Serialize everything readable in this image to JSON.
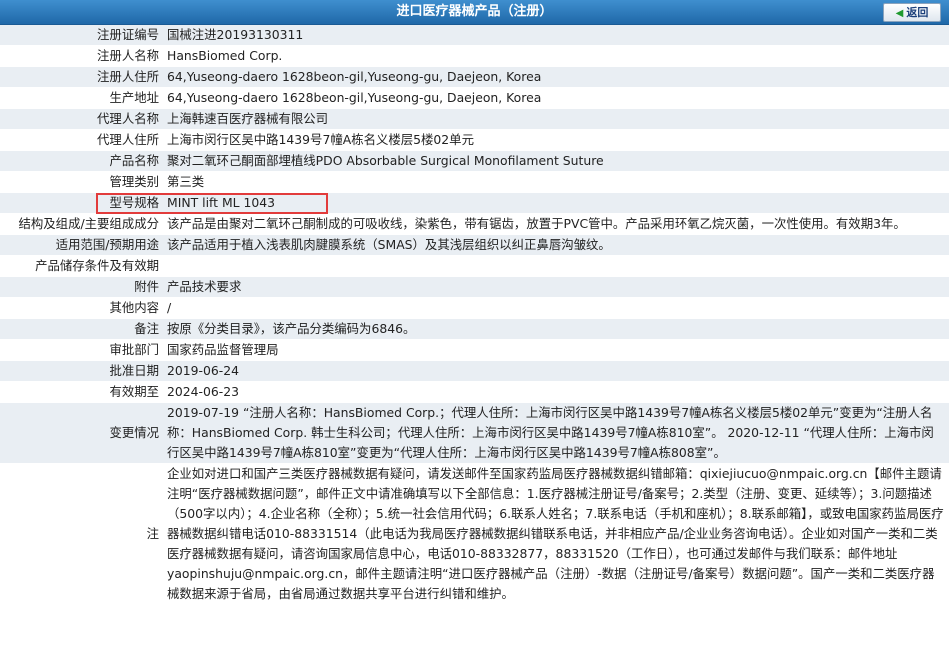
{
  "header": {
    "title": "进口医疗器械产品（注册）",
    "back_label": "返回"
  },
  "rows": [
    {
      "label": "注册证编号",
      "value": "国械注进20193130311"
    },
    {
      "label": "注册人名称",
      "value": "HansBiomed Corp."
    },
    {
      "label": "注册人住所",
      "value": "64,Yuseong-daero 1628beon-gil,Yuseong-gu, Daejeon, Korea"
    },
    {
      "label": "生产地址",
      "value": "64,Yuseong-daero 1628beon-gil,Yuseong-gu, Daejeon, Korea"
    },
    {
      "label": "代理人名称",
      "value": "上海韩速百医疗器械有限公司"
    },
    {
      "label": "代理人住所",
      "value": "上海市闵行区吴中路1439号7幢A栋名义楼层5楼02单元"
    },
    {
      "label": "产品名称",
      "value": "聚对二氧环己酮面部埋植线PDO Absorbable Surgical Monofilament Suture"
    },
    {
      "label": "管理类别",
      "value": "第三类"
    },
    {
      "label": "型号规格",
      "value": "MINT lift ML 1043"
    },
    {
      "label": "结构及组成/主要组成成分",
      "value": "该产品是由聚对二氧环己酮制成的可吸收线，染紫色，带有锯齿，放置于PVC管中。产品采用环氧乙烷灭菌，一次性使用。有效期3年。"
    },
    {
      "label": "适用范围/预期用途",
      "value": "该产品适用于植入浅表肌肉腱膜系统（SMAS）及其浅层组织以纠正鼻唇沟皱纹。"
    },
    {
      "label": "产品储存条件及有效期",
      "value": ""
    },
    {
      "label": "附件",
      "value": "产品技术要求"
    },
    {
      "label": "其他内容",
      "value": "/"
    },
    {
      "label": "备注",
      "value": "按原《分类目录》，该产品分类编码为6846。"
    },
    {
      "label": "审批部门",
      "value": "国家药品监督管理局"
    },
    {
      "label": "批准日期",
      "value": "2019-06-24"
    },
    {
      "label": "有效期至",
      "value": "2024-06-23"
    },
    {
      "label": "变更情况",
      "value": "2019-07-19 “注册人名称：HansBiomed Corp.；代理人住所：上海市闵行区吴中路1439号7幢A栋名义楼层5楼02单元”变更为“注册人名称：HansBiomed Corp. 韩士生科公司；代理人住所：上海市闵行区吴中路1439号7幢A栋810室”。 2020-12-11 “代理人住所：上海市闵行区吴中路1439号7幢A栋810室”变更为“代理人住所：上海市闵行区吴中路1439号7幢A栋808室”。"
    },
    {
      "label": "注",
      "value": "企业如对进口和国产三类医疗器械数据有疑问，请发送邮件至国家药监局医疗器械数据纠错邮箱：qixiejiucuo@nmpaic.org.cn【邮件主题请注明“医疗器械数据问题”，邮件正文中请准确填写以下全部信息：1.医疗器械注册证号/备案号；2.类型（注册、变更、延续等）；3.问题描述（500字以内）；4.企业名称（全称）；5.统一社会信用代码；6.联系人姓名；7.联系电话（手机和座机）；8.联系邮箱】，或致电国家药监局医疗器械数据纠错电话010-88331514（此电话为我局医疗器械数据纠错联系电话，并非相应产品/企业业务咨询电话）。企业如对国产一类和二类医疗器械数据有疑问，请咨询国家局信息中心，电话010-88332877，88331520（工作日），也可通过发邮件与我们联系：邮件地址yaopinshuju@nmpaic.org.cn，邮件主题请注明“进口医疗器械产品（注册）-数据（注册证号/备案号）数据问题”。国产一类和二类医疗器械数据来源于省局，由省局通过数据共享平台进行纠错和维护。"
    }
  ]
}
